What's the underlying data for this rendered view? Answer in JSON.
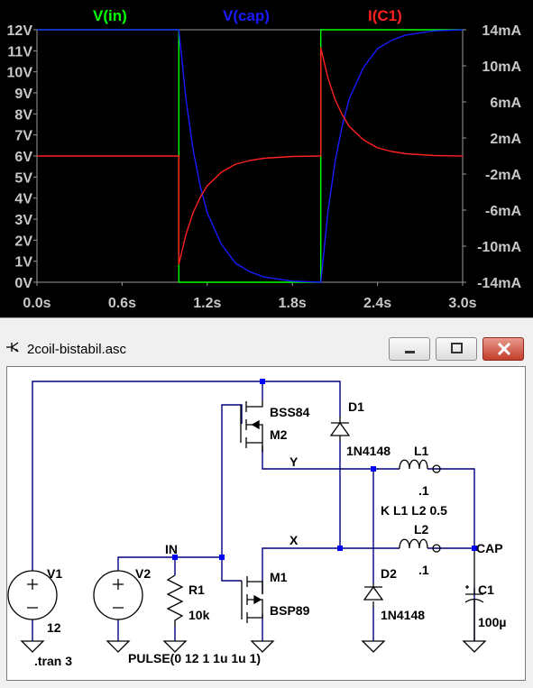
{
  "chart_data": {
    "type": "line",
    "series": [
      {
        "name": "V(in)",
        "color": "#00ff00",
        "axis": "left",
        "x": [
          0,
          1.0,
          1.0,
          2.0,
          2.0,
          3.0
        ],
        "y": [
          12,
          12,
          0,
          0,
          12,
          12
        ]
      },
      {
        "name": "V(cap)",
        "color": "#1a1aff",
        "axis": "left",
        "x": [
          0,
          1.0,
          1.0,
          1.05,
          1.1,
          1.15,
          1.2,
          1.3,
          1.4,
          1.5,
          1.6,
          1.8,
          2.0,
          2.0,
          2.05,
          2.1,
          2.15,
          2.2,
          2.3,
          2.4,
          2.5,
          2.6,
          2.8,
          3.0
        ],
        "y": [
          12,
          12,
          12,
          8.7,
          6.3,
          4.6,
          3.3,
          1.8,
          0.9,
          0.5,
          0.25,
          0.05,
          0,
          0,
          3.3,
          5.7,
          7.4,
          8.7,
          10.2,
          11.1,
          11.5,
          11.75,
          11.95,
          12
        ]
      },
      {
        "name": "I(C1)",
        "color": "#ff2020",
        "axis": "right",
        "x": [
          0,
          1.0,
          1.0,
          1.05,
          1.1,
          1.15,
          1.2,
          1.3,
          1.4,
          1.5,
          1.6,
          1.8,
          2.0,
          2.0,
          2.05,
          2.1,
          2.15,
          2.2,
          2.3,
          2.4,
          2.5,
          2.6,
          2.8,
          3.0
        ],
        "y": [
          0,
          0,
          -12,
          -8.7,
          -6.3,
          -4.6,
          -3.3,
          -1.8,
          -0.9,
          -0.5,
          -0.25,
          -0.05,
          0,
          12,
          8.7,
          6.3,
          4.6,
          3.3,
          1.8,
          0.9,
          0.5,
          0.25,
          0.05,
          0
        ]
      }
    ],
    "xlim": [
      0,
      3
    ],
    "ylim_left": [
      0,
      12
    ],
    "ylim_right": [
      -14,
      14
    ],
    "x_ticks": [
      "0.0s",
      "0.6s",
      "1.2s",
      "1.8s",
      "2.4s",
      "3.0s"
    ],
    "y_ticks_left": [
      "12V",
      "11V",
      "10V",
      "9V",
      "8V",
      "7V",
      "6V",
      "5V",
      "4V",
      "3V",
      "2V",
      "1V",
      "0V"
    ],
    "y_ticks_right": [
      "14mA",
      "10mA",
      "6mA",
      "2mA",
      "-2mA",
      "-6mA",
      "-10mA",
      "-14mA"
    ],
    "grid": false
  },
  "colors": {
    "background": "#000000",
    "axis_text": "#c8c8c8",
    "wire": "#00007f",
    "junction": "#0000ff",
    "component": "#000000"
  },
  "window": {
    "title": "2coil-bistabil.asc",
    "minimize_icon": "minimize-icon",
    "maximize_icon": "maximize-icon",
    "close_icon": "close-icon",
    "app_icon": "ltspice-probe-icon"
  },
  "schematic": {
    "labels": {
      "m2_model": "BSS84",
      "m2_name": "M2",
      "m1_model": "BSP89",
      "m1_name": "M1",
      "d1_name": "D1",
      "d1_model": "1N4148",
      "d2_name": "D2",
      "d2_model": "1N4148",
      "l1_name": "L1",
      "l1_value": ".1",
      "l2_name": "L2",
      "l2_value": ".1",
      "coupling": "K L1 L2 0.5",
      "net_y": "Y",
      "net_x": "X",
      "net_in": "IN",
      "net_cap": "CAP",
      "v1_name": "V1",
      "v1_value": "12",
      "v2_name": "V2",
      "v2_value": "PULSE(0 12 1 1u 1u 1)",
      "r1_name": "R1",
      "r1_value": "10k",
      "c1_name": "C1",
      "c1_value": "100µ",
      "directive": ".tran 3"
    }
  }
}
